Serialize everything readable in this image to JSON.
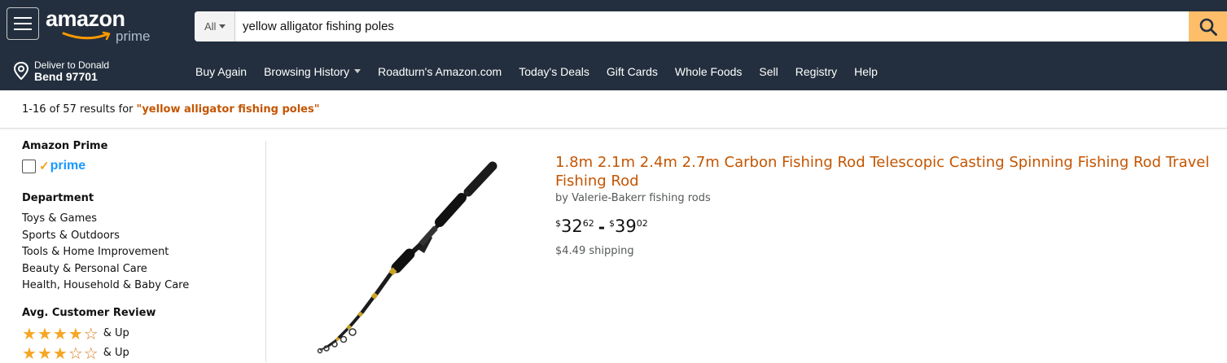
{
  "header": {
    "logo_text": "amazon",
    "logo_sub": "prime",
    "search_scope": "All",
    "search_value": "yellow alligator fishing poles"
  },
  "nav": {
    "deliver_line1": "Deliver to Donald",
    "deliver_line2": "Bend 97701",
    "links": [
      "Buy Again",
      "Browsing History",
      "Roadturn's Amazon.com",
      "Today's Deals",
      "Gift Cards",
      "Whole Foods",
      "Sell",
      "Registry",
      "Help"
    ]
  },
  "results": {
    "summary": "1-16 of 57 results for",
    "query": "\"yellow alligator fishing poles\""
  },
  "sidebar": {
    "prime_heading": "Amazon Prime",
    "prime_badge_check": "✓",
    "prime_badge_text": "prime",
    "department_heading": "Department",
    "departments": [
      "Toys & Games",
      "Sports & Outdoors",
      "Tools & Home Improvement",
      "Beauty & Personal Care",
      "Health, Household & Baby Care"
    ],
    "review_heading": "Avg. Customer Review",
    "review_rows": [
      {
        "filled": 4,
        "label": "& Up"
      },
      {
        "filled": 3,
        "label": "& Up"
      }
    ]
  },
  "product": {
    "title": "1.8m 2.1m 2.4m 2.7m Carbon Fishing Rod Telescopic Casting Spinning Fishing Rod Travel Fishing Rod",
    "by": "by Valerie-Bakerr fishing rods",
    "price_low": {
      "symbol": "$",
      "whole": "32",
      "fraction": "62"
    },
    "price_dash": "-",
    "price_high": {
      "symbol": "$",
      "whole": "39",
      "fraction": "02"
    },
    "shipping": "$4.49 shipping"
  },
  "colors": {
    "header_bg": "#232f3e",
    "search_button": "#febd69",
    "link_orange": "#c45500",
    "prime_blue": "#1a98ff",
    "star": "#f5a623"
  }
}
